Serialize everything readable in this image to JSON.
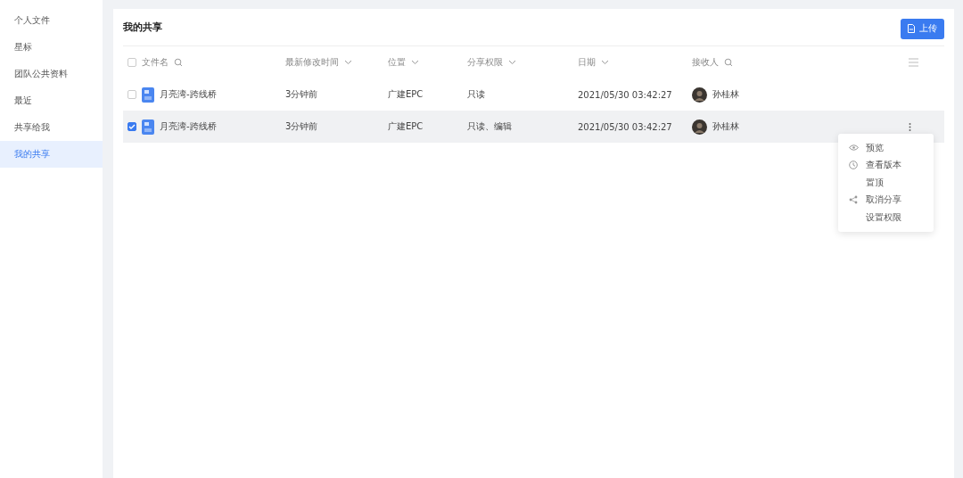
{
  "sidebar": {
    "items": [
      {
        "label": "个人文件",
        "selected": false
      },
      {
        "label": "星标",
        "selected": false
      },
      {
        "label": "团队公共资料",
        "selected": false
      },
      {
        "label": "最近",
        "selected": false
      },
      {
        "label": "共享给我",
        "selected": false
      },
      {
        "label": "我的共享",
        "selected": true
      }
    ]
  },
  "page": {
    "title": "我的共享",
    "upload_button": "上传"
  },
  "table": {
    "select_all": {
      "checked": false
    },
    "columns": [
      {
        "label": "文件名",
        "kind": "search"
      },
      {
        "label": "最新修改时间",
        "kind": "sort"
      },
      {
        "label": "位置",
        "kind": "sort"
      },
      {
        "label": "分享权限",
        "kind": "sort"
      },
      {
        "label": "日期",
        "kind": "sort"
      },
      {
        "label": "接收人",
        "kind": "search"
      }
    ],
    "rows": [
      {
        "name": "月亮湾-跨线桥",
        "modified": "3分钟前",
        "location": "广建EPC",
        "permission": "只读",
        "date": "2021/05/30 03:42:27",
        "receiver": "孙桂林",
        "selected": false,
        "checked": false
      },
      {
        "name": "月亮湾-跨线桥",
        "modified": "3分钟前",
        "location": "广建EPC",
        "permission": "只读、编辑",
        "date": "2021/05/30 03:42:27",
        "receiver": "孙桂林",
        "selected": true,
        "checked": true
      }
    ]
  },
  "context_menu": {
    "items": [
      {
        "label": "预览",
        "kind": "eye"
      },
      {
        "label": "查看版本",
        "kind": "clock"
      },
      {
        "label": "置顶",
        "kind": "plain"
      },
      {
        "label": "取消分享",
        "kind": "share"
      },
      {
        "label": "设置权限",
        "kind": "plain"
      }
    ]
  }
}
